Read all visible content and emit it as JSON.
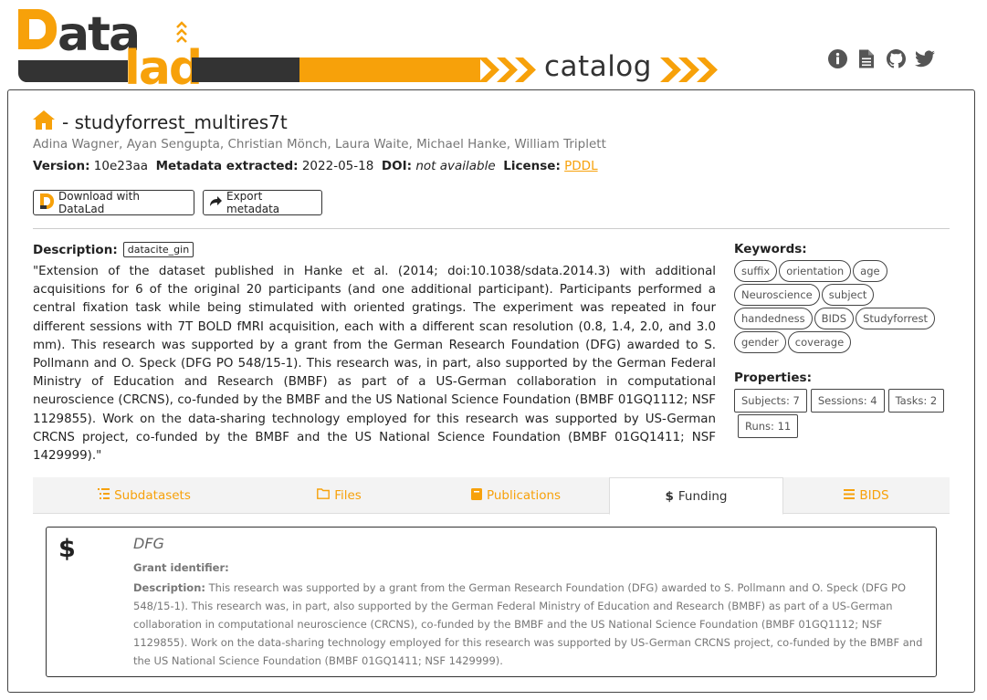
{
  "header": {
    "logo_text": "DataLad",
    "catalog_text": "catalog",
    "icons": [
      "info-icon",
      "file-icon",
      "github-icon",
      "twitter-icon"
    ]
  },
  "dataset": {
    "title": "- studyforrest_multires7t",
    "authors": "Adina Wagner, Ayan Sengupta, Christian Mönch, Laura Waite, Michael Hanke, William Triplett",
    "version_label": "Version:",
    "version": "10e23aa",
    "metadata_label": "Metadata extracted:",
    "metadata_date": "2022-05-18",
    "doi_label": "DOI:",
    "doi": "not available",
    "license_label": "License:",
    "license": "PDDL"
  },
  "buttons": {
    "download": "Download with DataLad",
    "export": "Export metadata"
  },
  "description": {
    "label": "Description:",
    "source_tag": "datacite_gin",
    "text": "\"Extension of the dataset published in Hanke et al. (2014; doi:10.1038/sdata.2014.3) with additional acquisitions for 6 of the original 20 participants (and one additional participant). Participants performed a central fixation task while being stimulated with oriented gratings. The experiment was repeated in four different sessions with 7T BOLD fMRI acquisition, each with a different scan resolution (0.8, 1.4, 2.0, and 3.0 mm). This research was supported by a grant from the German Research Foundation (DFG) awarded to S. Pollmann and O. Speck (DFG PO 548/15-1). This research was, in part, also supported by the German Federal Ministry of Education and Research (BMBF) as part of a US-German collaboration in computational neuroscience (CRCNS), co-funded by the BMBF and the US National Science Foundation (BMBF 01GQ1112; NSF 1129855). Work on the data-sharing technology employed for this research was supported by US-German CRCNS project, co-funded by the BMBF and the US National Science Foundation (BMBF 01GQ1411; NSF 1429999).\""
  },
  "keywords": {
    "label": "Keywords:",
    "rows": [
      [
        "suffix",
        "orientation",
        "age"
      ],
      [
        "Neuroscience",
        "subject"
      ],
      [
        "handedness",
        "BIDS",
        "Studyforrest"
      ],
      [
        "gender",
        "coverage"
      ]
    ]
  },
  "properties": {
    "label": "Properties:",
    "rows": [
      [
        "Subjects: 7",
        "Sessions: 4",
        "Tasks: 2"
      ],
      [
        "Runs: 11"
      ]
    ]
  },
  "tabs": [
    {
      "label": "Subdatasets",
      "icon": "list-icon"
    },
    {
      "label": "Files",
      "icon": "folder-icon"
    },
    {
      "label": "Publications",
      "icon": "book-icon"
    },
    {
      "label": "Funding",
      "icon": "dollar-icon"
    },
    {
      "label": "BIDS",
      "icon": "bars-icon"
    }
  ],
  "active_tab": "Funding",
  "funding": {
    "symbol": "$",
    "name": "DFG",
    "grant_label": "Grant identifier:",
    "desc_label": "Description:",
    "desc_text": "This research was supported by a grant from the German Research Foundation (DFG) awarded to S. Pollmann and O. Speck (DFG PO 548/15-1). This research was, in part, also supported by the German Federal Ministry of Education and Research (BMBF) as part of a US-German collaboration in computational neuroscience (CRCNS), co-funded by the BMBF and the US National Science Foundation (BMBF 01GQ1112; NSF 1129855). Work on the data-sharing technology employed for this research was supported by US-German CRCNS project, co-funded by the BMBF and the US National Science Foundation (BMBF 01GQ1411; NSF 1429999)."
  },
  "colors": {
    "accent": "#f7a10a",
    "dark": "#333333",
    "muted": "#777777"
  }
}
